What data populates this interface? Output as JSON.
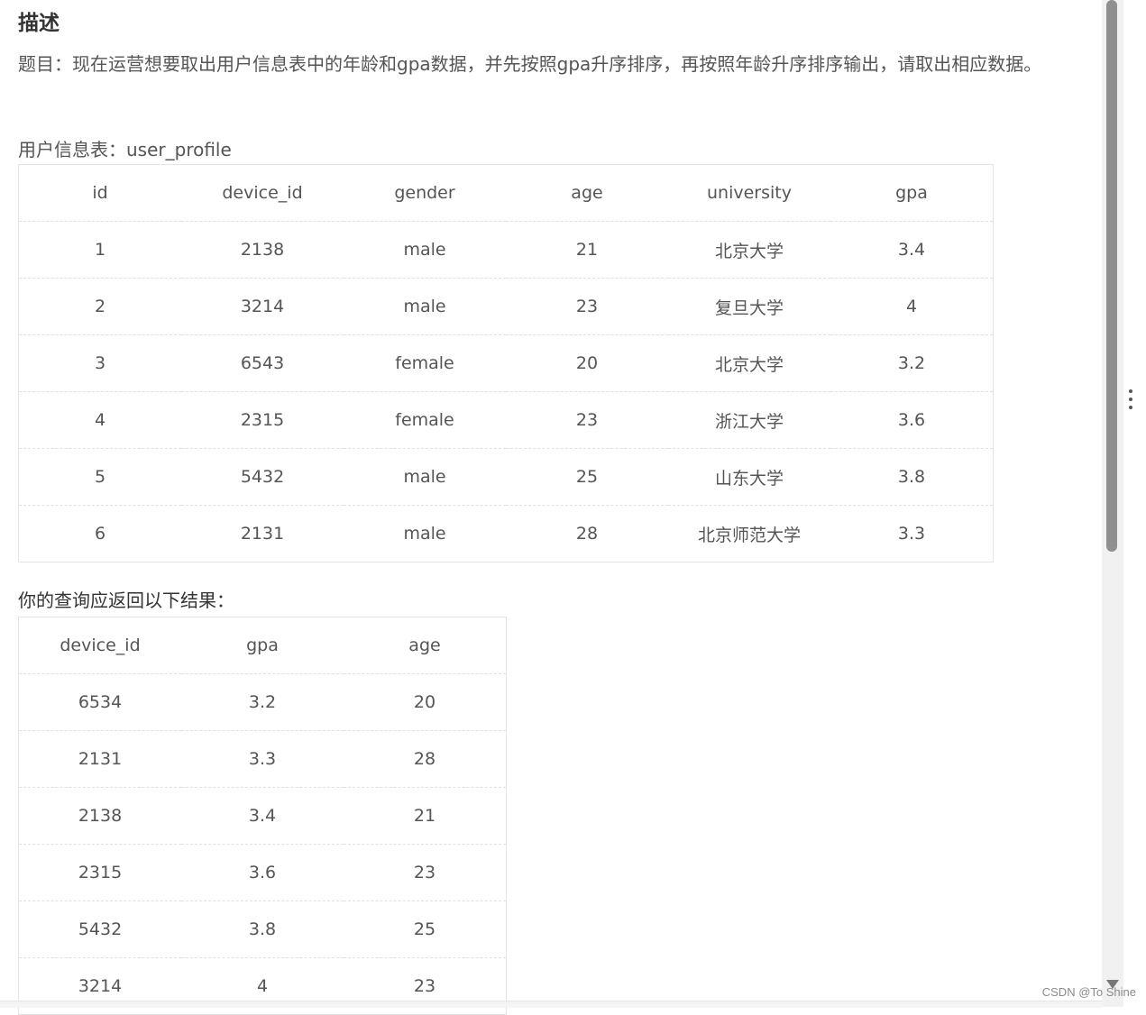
{
  "heading": "描述",
  "description": "题目：现在运营想要取出用户信息表中的年龄和gpa数据，并先按照gpa升序排序，再按照年龄升序排序输出，请取出相应数据。",
  "table1": {
    "label": "用户信息表：user_profile",
    "headers": [
      "id",
      "device_id",
      "gender",
      "age",
      "university",
      "gpa"
    ],
    "rows": [
      [
        "1",
        "2138",
        "male",
        "21",
        "北京大学",
        "3.4"
      ],
      [
        "2",
        "3214",
        "male",
        "23",
        "复旦大学",
        "4"
      ],
      [
        "3",
        "6543",
        "female",
        "20",
        "北京大学",
        "3.2"
      ],
      [
        "4",
        "2315",
        "female",
        "23",
        "浙江大学",
        "3.6"
      ],
      [
        "5",
        "5432",
        "male",
        "25",
        "山东大学",
        "3.8"
      ],
      [
        "6",
        "2131",
        "male",
        "28",
        "北京师范大学",
        "3.3"
      ]
    ]
  },
  "table2": {
    "label": "你的查询应返回以下结果：",
    "headers": [
      "device_id",
      "gpa",
      "age"
    ],
    "rows": [
      [
        "6534",
        "3.2",
        "20"
      ],
      [
        "2131",
        "3.3",
        "28"
      ],
      [
        "2138",
        "3.4",
        "21"
      ],
      [
        "2315",
        "3.6",
        "23"
      ],
      [
        "5432",
        "3.8",
        "25"
      ],
      [
        "3214",
        "4",
        "23"
      ]
    ]
  },
  "watermark": "CSDN @To Shine"
}
